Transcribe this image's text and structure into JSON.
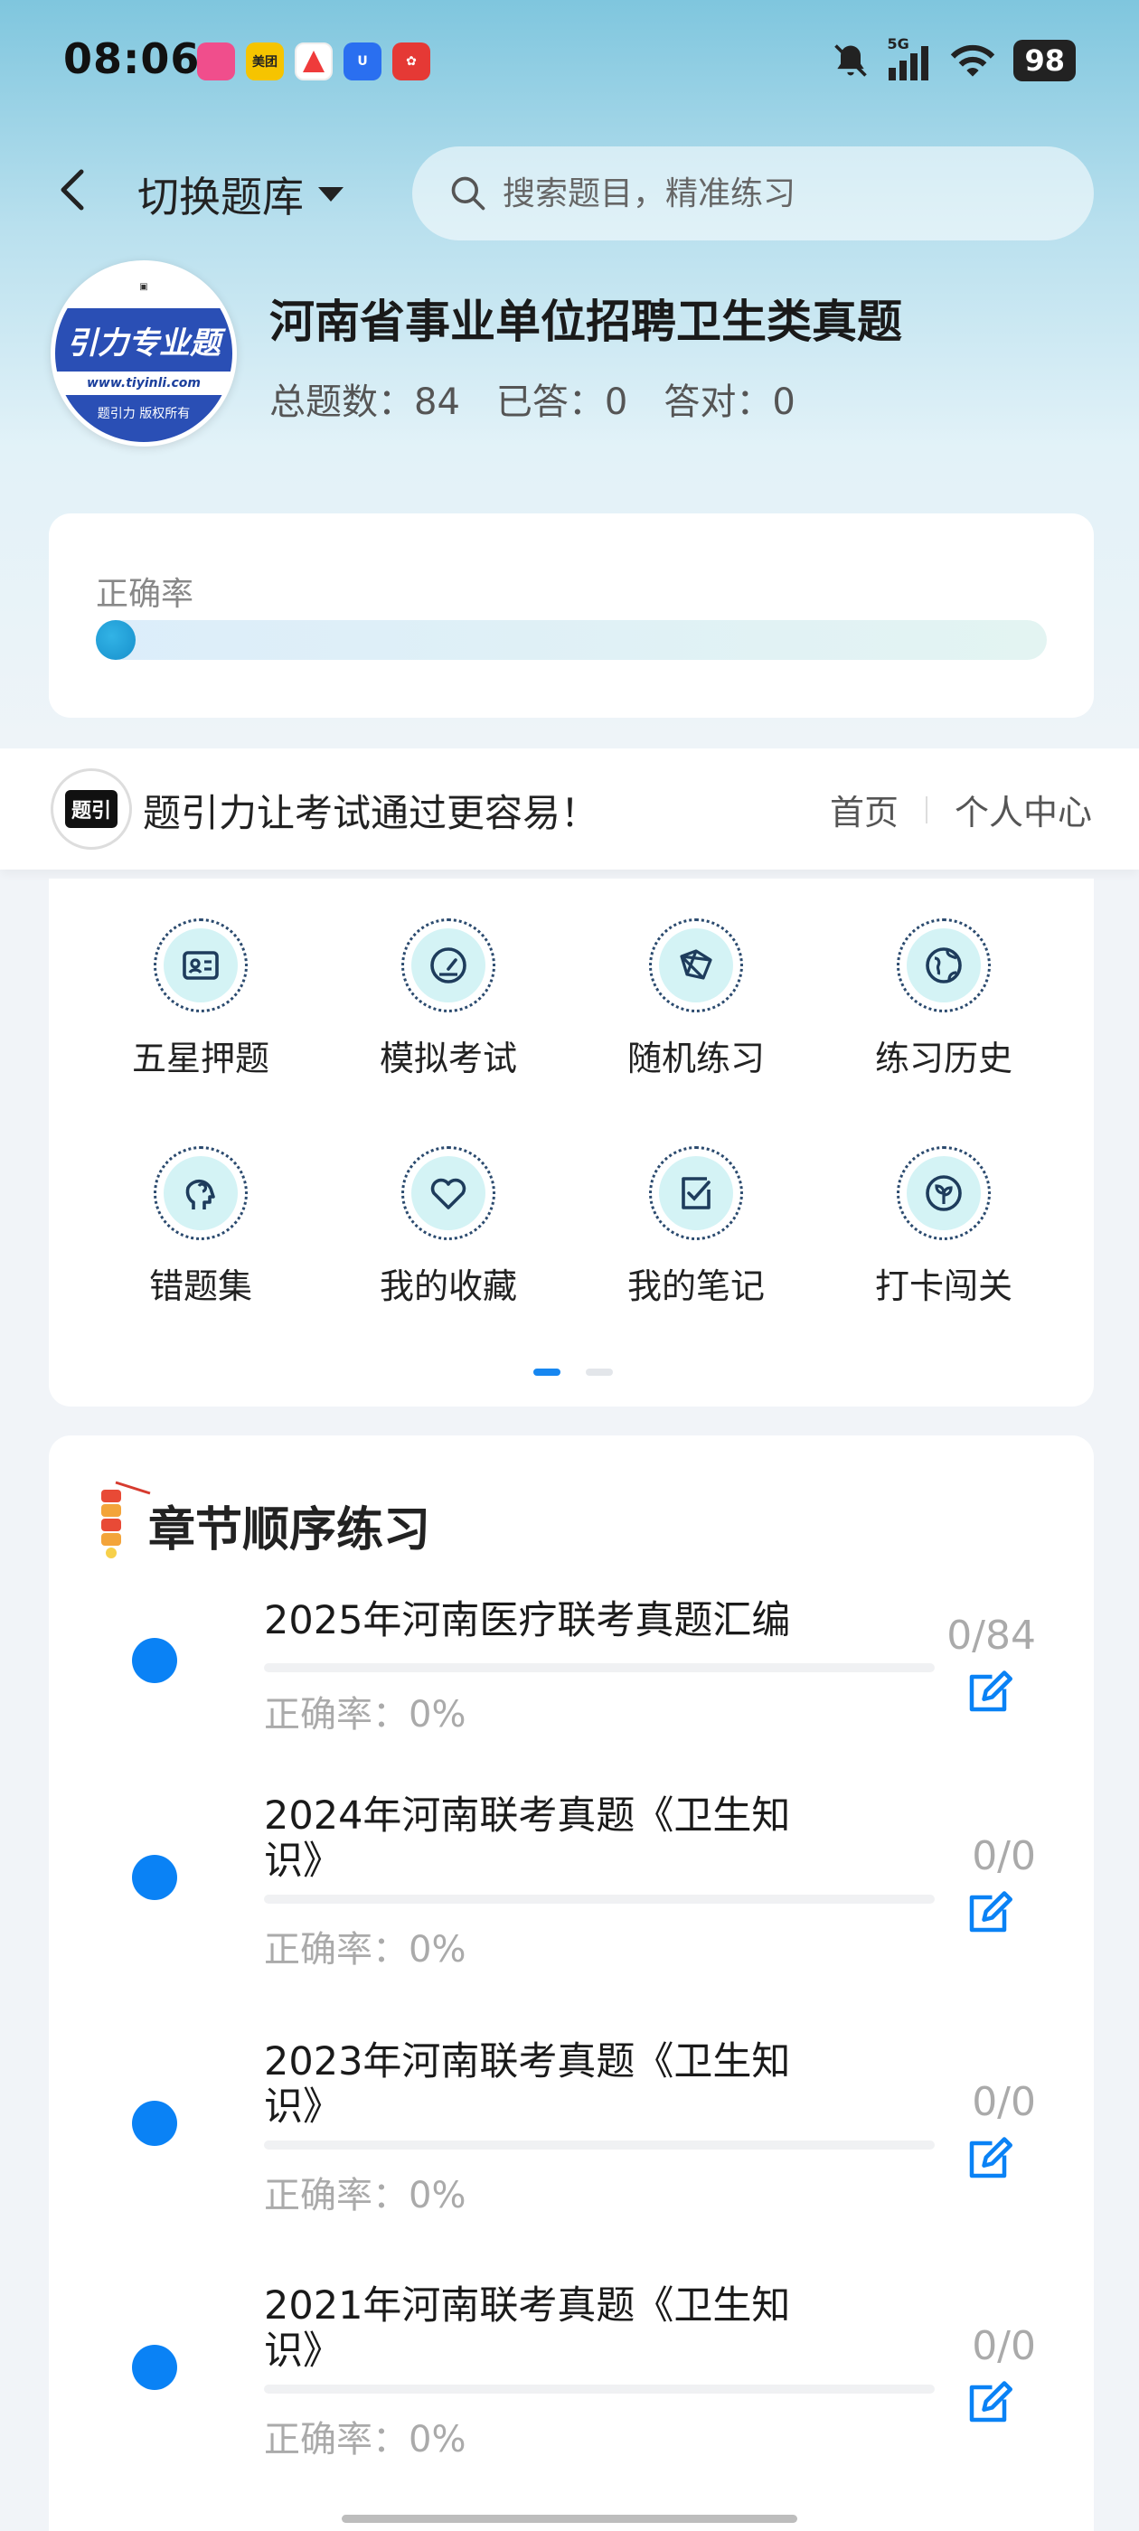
{
  "status_bar": {
    "time": "08:06",
    "app_icons": [
      {
        "name": "lilili-app",
        "label": "lilili",
        "color": "#f04e8c"
      },
      {
        "name": "meituan-app",
        "label": "美团",
        "color": "#f6c400"
      },
      {
        "name": "a-app",
        "label": "",
        "color": "#ef3b3b"
      },
      {
        "name": "u-app",
        "label": "",
        "color": "#2a6ff0"
      },
      {
        "name": "red-app",
        "label": "",
        "color": "#e53935"
      }
    ],
    "network": "5G",
    "battery": "98"
  },
  "header": {
    "switch_label": "切换题库",
    "search_placeholder": "搜索题目，精准练习"
  },
  "bank": {
    "logo_text": "引力专业题",
    "logo_url": "www.tiyinli.com",
    "logo_footer": "题引力 版权所有",
    "title": "河南省事业单位招聘卫生类真题",
    "stats": [
      {
        "label": "总题数：",
        "value": "84"
      },
      {
        "label": "已答：",
        "value": "0"
      },
      {
        "label": "答对：",
        "value": "0"
      }
    ]
  },
  "accuracy": {
    "label": "正确率",
    "value_fraction": 0
  },
  "ad_banner": {
    "text": "题引力让考试通过更容易！",
    "links": [
      "首页",
      "个人中心"
    ]
  },
  "functions": [
    {
      "label": "五星押题",
      "icon": "id-card-icon"
    },
    {
      "label": "模拟考试",
      "icon": "speedometer-icon"
    },
    {
      "label": "随机练习",
      "icon": "network-icon"
    },
    {
      "label": "练习历史",
      "icon": "globe-icon"
    },
    {
      "label": "错题集",
      "icon": "head-icon"
    },
    {
      "label": "我的收藏",
      "icon": "heart-icon"
    },
    {
      "label": "我的笔记",
      "icon": "note-check-icon"
    },
    {
      "label": "打卡闯关",
      "icon": "leaf-icon"
    }
  ],
  "chapters": {
    "title": "章节顺序练习",
    "items": [
      {
        "name": "2025年河南医疗联考真题汇编",
        "count": "0/84",
        "accuracy": "正确率：0%"
      },
      {
        "name": "2024年河南联考真题《卫生知识》",
        "count": "0/0",
        "accuracy": "正确率：0%"
      },
      {
        "name": "2023年河南联考真题《卫生知识》",
        "count": "0/0",
        "accuracy": "正确率：0%"
      },
      {
        "name": "2021年河南联考真题《卫生知识》",
        "count": "0/0",
        "accuracy": "正确率：0%"
      }
    ]
  },
  "colors": {
    "accent": "#0a82f5",
    "icon_fill": "#d4f3f5",
    "icon_stroke": "#2b4a6e"
  }
}
